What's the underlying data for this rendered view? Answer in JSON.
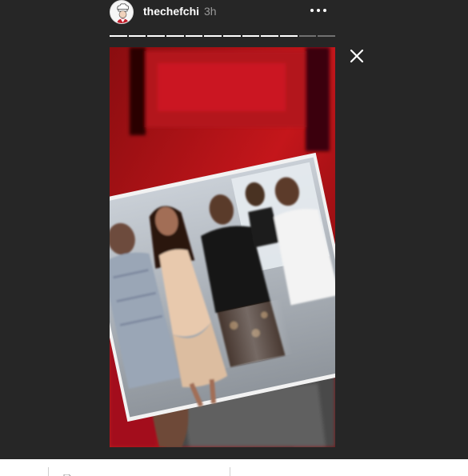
{
  "story": {
    "username": "thechefchi",
    "timestamp": "3h",
    "progress": {
      "segments_total": 12,
      "segments_viewed": 10
    }
  },
  "icons": {
    "avatar": "chef-avatar-icon",
    "more": "more-options-icon",
    "close": "close-icon",
    "document": "document-icon"
  },
  "colors": {
    "background": "#262626",
    "text_primary": "#ffffff",
    "text_secondary": "#9a9a9a",
    "progress_active": "#ffffff",
    "progress_inactive": "rgba(255,255,255,0.35)",
    "bottom_bar": "#ffffff"
  }
}
